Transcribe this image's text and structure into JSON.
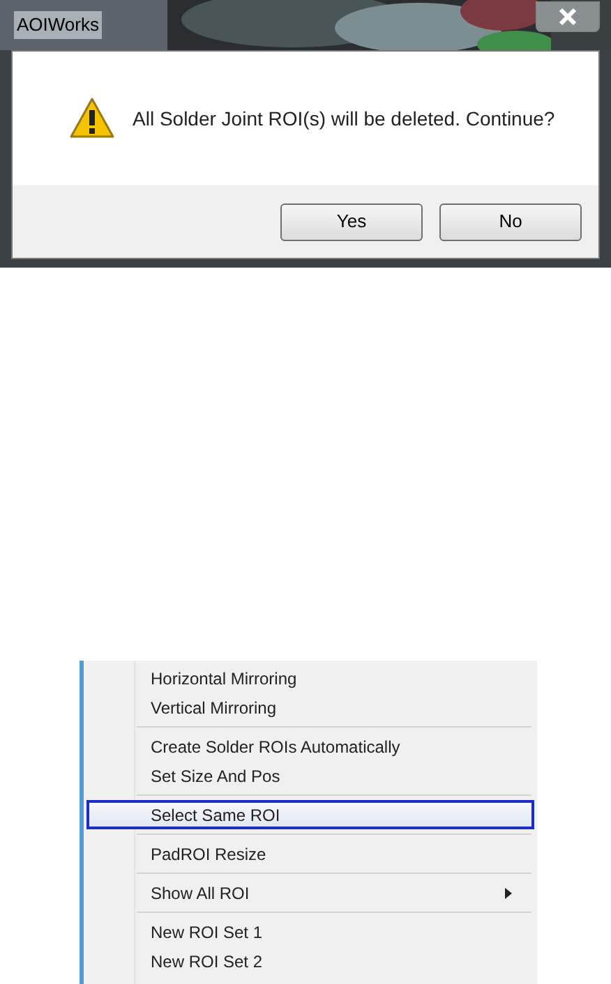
{
  "dialog": {
    "title": "AOIWorks",
    "message": "All Solder Joint ROI(s) will be deleted. Continue?",
    "buttons": [
      "Yes",
      "No"
    ]
  },
  "context_menu": {
    "items": [
      {
        "kind": "item",
        "label": "Horizontal Mirroring",
        "selected": false
      },
      {
        "kind": "item",
        "label": "Vertical Mirroring",
        "selected": false
      },
      {
        "kind": "separator"
      },
      {
        "kind": "item",
        "label": "Create Solder ROIs Automatically",
        "selected": false
      },
      {
        "kind": "item",
        "label": "Set Size And Pos",
        "selected": false
      },
      {
        "kind": "separator"
      },
      {
        "kind": "item",
        "label": "Select Same ROI",
        "selected": true
      },
      {
        "kind": "separator"
      },
      {
        "kind": "item",
        "label": "PadROI Resize",
        "selected": false
      },
      {
        "kind": "separator"
      },
      {
        "kind": "submenu",
        "label": "Show All ROI",
        "selected": false
      },
      {
        "kind": "separator"
      },
      {
        "kind": "item",
        "label": "New ROI Set 1",
        "selected": false
      },
      {
        "kind": "item",
        "label": "New ROI Set 2",
        "selected": false
      }
    ]
  }
}
